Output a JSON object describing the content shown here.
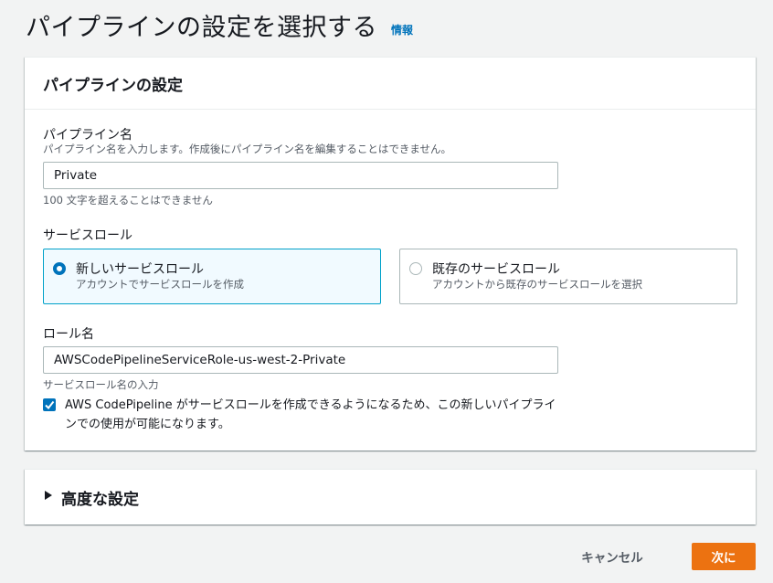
{
  "page": {
    "title": "パイプラインの設定を選択する",
    "info_link": "情報"
  },
  "pipeline_settings": {
    "header": "パイプラインの設定",
    "name_label": "パイプライン名",
    "name_desc": "パイプライン名を入力します。作成後にパイプライン名を編集することはできません。",
    "name_value": "Private",
    "name_constraint": "100 文字を超えることはできません",
    "service_role_label": "サービスロール",
    "role_options": [
      {
        "title": "新しいサービスロール",
        "desc": "アカウントでサービスロールを作成",
        "selected": true
      },
      {
        "title": "既存のサービスロール",
        "desc": "アカウントから既存のサービスロールを選択",
        "selected": false
      }
    ],
    "role_name_label": "ロール名",
    "role_name_value": "AWSCodePipelineServiceRole-us-west-2-Private",
    "role_name_hint": "サービスロール名の入力",
    "allow_checkbox": {
      "checked": true,
      "label": "AWS CodePipeline がサービスロールを作成できるようになるため、この新しいパイプラインでの使用が可能になります。"
    }
  },
  "advanced": {
    "title": "高度な設定",
    "icon": "caret-right-icon"
  },
  "footer": {
    "cancel_label": "キャンセル",
    "next_label": "次に"
  },
  "colors": {
    "primary_button": "#ec7211",
    "link": "#0073bb",
    "selected_border": "#00a1c9",
    "selected_bg": "#f1faff"
  }
}
